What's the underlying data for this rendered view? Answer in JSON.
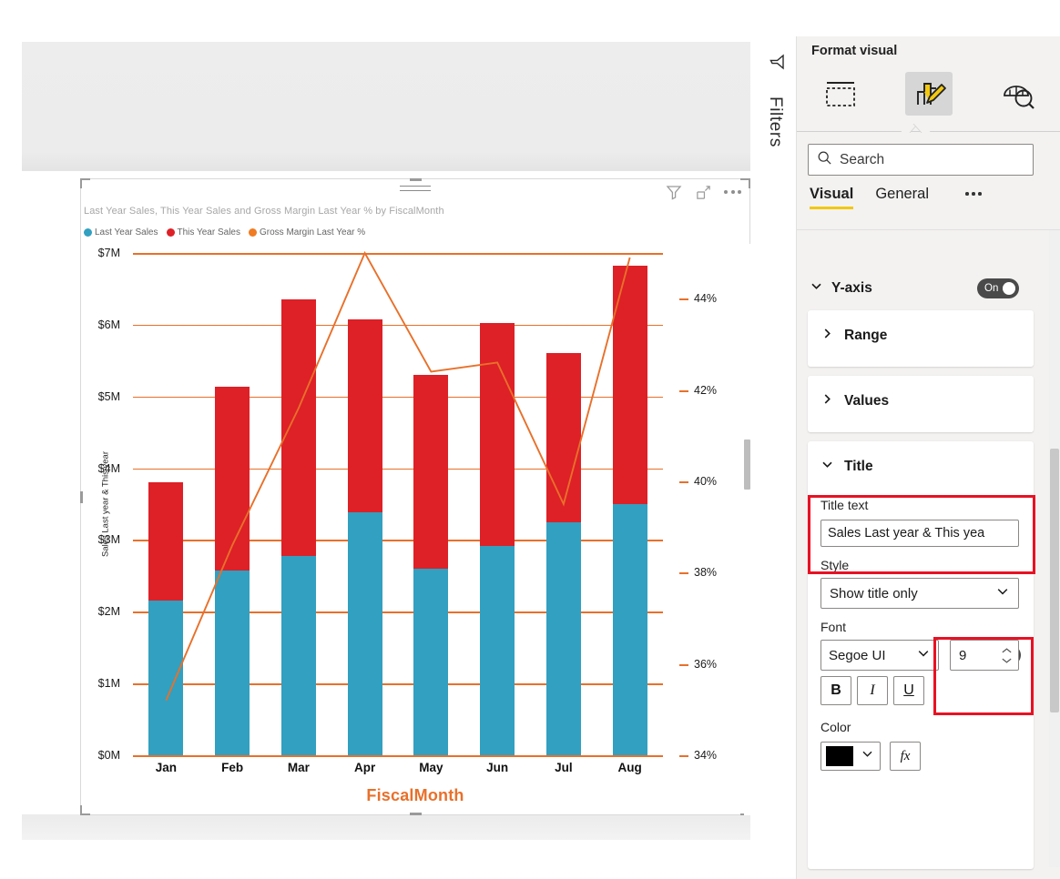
{
  "canvas": {
    "visual_header": {
      "filter_icon": "filter-icon",
      "focus_icon": "focus-mode-icon",
      "more_icon": "more-options-icon"
    }
  },
  "filters_rail": {
    "label": "Filters",
    "icon": "filter-funnel-icon"
  },
  "format_pane": {
    "title": "Format visual",
    "icon_tabs": [
      {
        "name": "build-visual-icon",
        "active": false
      },
      {
        "name": "format-visual-icon",
        "active": true
      },
      {
        "name": "analytics-icon",
        "active": false
      }
    ],
    "search": {
      "placeholder": "Search",
      "icon": "search-icon"
    },
    "tabs": [
      {
        "label": "Visual",
        "active": true
      },
      {
        "label": "General",
        "active": false
      }
    ],
    "tabs_overflow": "more-tabs-icon",
    "sections": {
      "y_axis": {
        "label": "Y-axis",
        "toggle": "On",
        "expanded": true
      },
      "range": {
        "label": "Range",
        "expanded": false
      },
      "values": {
        "label": "Values",
        "expanded": false
      },
      "title": {
        "label": "Title",
        "toggle": "On",
        "expanded": true,
        "title_text_label": "Title text",
        "title_text_value": "Sales Last year & This yea",
        "style_label": "Style",
        "style_value": "Show title only",
        "font_label": "Font",
        "font_family_value": "Segoe UI",
        "font_size_value": "9",
        "bold_label": "B",
        "italic_label": "I",
        "underline_label": "U",
        "color_label": "Color",
        "color_value": "#000000",
        "fx_label": "fx"
      }
    }
  },
  "chart_data": {
    "type": "bar",
    "title": "Last Year Sales, This Year Sales and Gross Margin Last Year % by FiscalMonth",
    "categories": [
      "Jan",
      "Feb",
      "Mar",
      "Apr",
      "May",
      "Jun",
      "Jul",
      "Aug"
    ],
    "xlabel": "FiscalMonth",
    "ylabel": "Sales Last year & This year",
    "y2label": "Gross Margin Last Year %",
    "ylim": [
      0,
      7
    ],
    "y_ticks": [
      "$0M",
      "$1M",
      "$2M",
      "$3M",
      "$4M",
      "$5M",
      "$6M",
      "$7M"
    ],
    "y2lim": [
      34,
      45
    ],
    "y2_ticks": [
      "34%",
      "36%",
      "38%",
      "40%",
      "42%",
      "44%"
    ],
    "grid": true,
    "legend_position": "top-left",
    "stacked": true,
    "series": [
      {
        "name": "Last Year Sales",
        "type": "bar",
        "color": "#31A0C1",
        "values": [
          2.15,
          2.58,
          2.78,
          3.38,
          2.6,
          2.92,
          3.25,
          3.5
        ]
      },
      {
        "name": "This Year Sales",
        "type": "bar",
        "color": "#DE2027",
        "values": [
          1.66,
          2.55,
          3.57,
          2.69,
          2.7,
          3.1,
          2.36,
          3.32
        ]
      },
      {
        "name": "Gross Margin Last Year %",
        "type": "line",
        "color": "#E8702A",
        "values": [
          35.2,
          38.6,
          41.6,
          45.0,
          42.4,
          42.6,
          39.5,
          44.9
        ]
      }
    ]
  }
}
